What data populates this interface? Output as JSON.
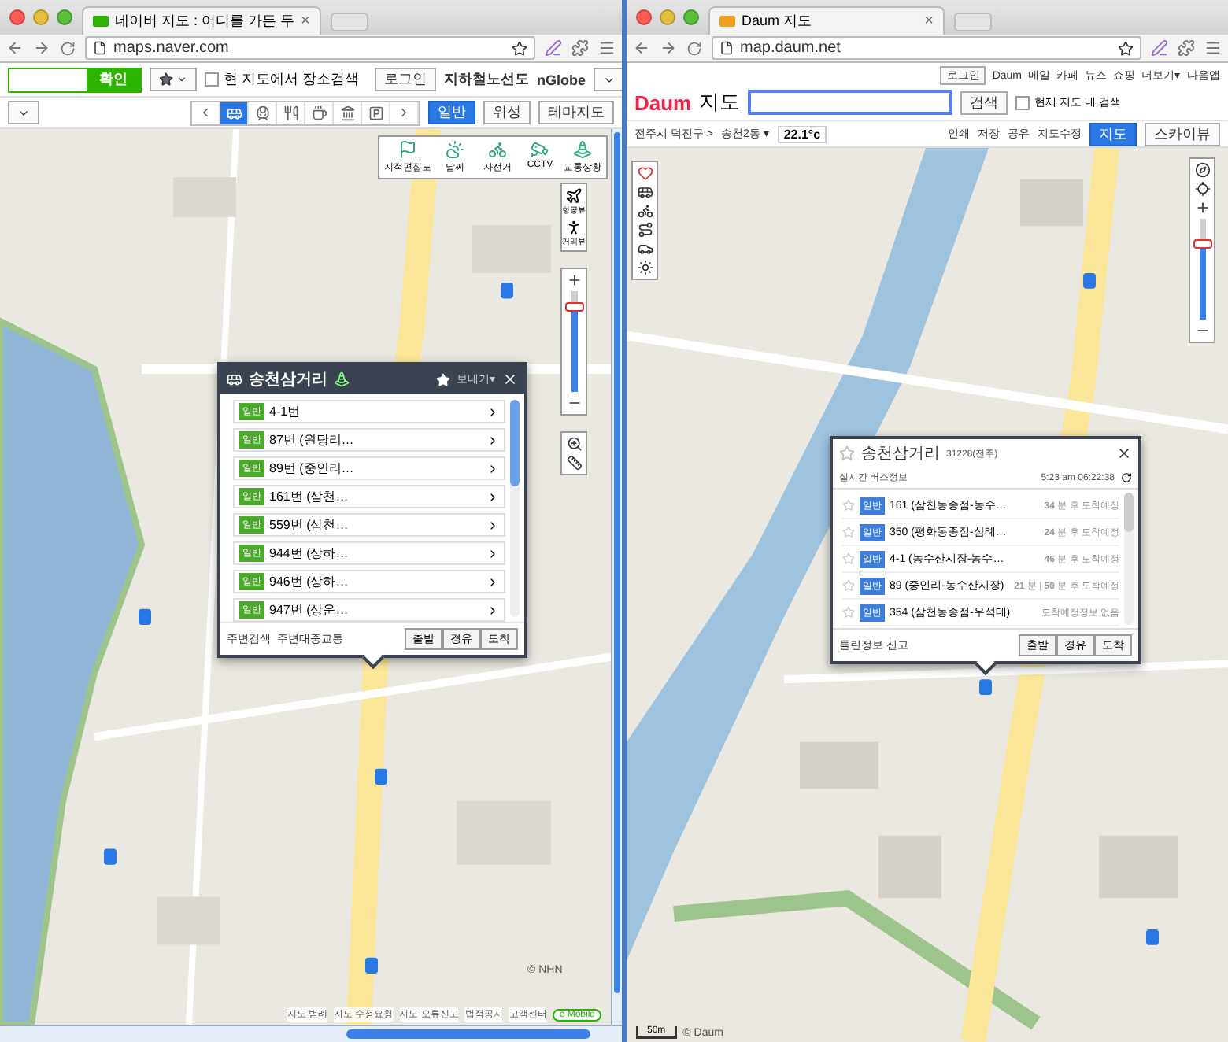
{
  "left_window": {
    "tab": {
      "title": "네이버 지도 : 어디를 가든 두",
      "close": "×"
    },
    "url": "maps.naver.com",
    "header": {
      "search_button": "확인",
      "place_search": {
        "label": "현 지도에서 장소검색",
        "checked": false
      },
      "login": "로그인",
      "links": [
        "지하철노선도",
        "nGlobe"
      ]
    },
    "categories": [
      {
        "kind": "bus",
        "selected": true
      },
      {
        "kind": "subway",
        "selected": false
      },
      {
        "kind": "restaurant",
        "selected": false
      },
      {
        "kind": "cafe",
        "selected": false
      },
      {
        "kind": "bank",
        "selected": false
      },
      {
        "kind": "parking",
        "selected": false
      }
    ],
    "map_types": [
      {
        "label": "일반",
        "selected": true
      },
      {
        "label": "위성",
        "selected": false
      },
      {
        "label": "테마지도",
        "selected": false
      }
    ],
    "layers": [
      {
        "label": "지적편집도",
        "kind": "flag"
      },
      {
        "label": "날씨",
        "kind": "weather"
      },
      {
        "label": "자전거",
        "kind": "bike"
      },
      {
        "label": "CCTV",
        "kind": "cctv"
      },
      {
        "label": "교통상황",
        "kind": "traffic"
      }
    ],
    "view_buttons": [
      "항공뷰",
      "거리뷰"
    ],
    "zoom": {
      "level": 0.85
    },
    "popup": {
      "title": "송천삼거리",
      "send": "보내기▾",
      "routes": [
        {
          "badge": "일반",
          "name": "4-1번"
        },
        {
          "badge": "일반",
          "name": "87번 (원당리…"
        },
        {
          "badge": "일반",
          "name": "89번 (중인리…"
        },
        {
          "badge": "일반",
          "name": "161번 (삼천…"
        },
        {
          "badge": "일반",
          "name": "559번 (삼천…"
        },
        {
          "badge": "일반",
          "name": "944번 (상하…"
        },
        {
          "badge": "일반",
          "name": "946번 (상하…"
        },
        {
          "badge": "일반",
          "name": "947번 (상운…"
        }
      ],
      "links": [
        "주변검색",
        "주변대중교통"
      ],
      "buttons": [
        "출발",
        "경유",
        "도착"
      ]
    },
    "footer": {
      "links": [
        "지도 범례",
        "지도 수정요청",
        "지도 오류신고",
        "법적공지",
        "고객센터"
      ],
      "copyright": "© NHN",
      "mobile": "e Mobile"
    }
  },
  "right_window": {
    "tab": {
      "title": "Daum 지도",
      "close": "×"
    },
    "url": "map.daum.net",
    "header": {
      "logo": "Daum",
      "logo_suffix": "지도",
      "login": "로그인",
      "links": [
        "Daum",
        "메일",
        "카페",
        "뉴스",
        "쇼핑",
        "더보기▾",
        "다음앱"
      ],
      "search_button": "검색",
      "area_search": {
        "label": "현재 지도 내 검색",
        "checked": false
      }
    },
    "breadcrumb": [
      "전주시 덕진구 >",
      "송천2동 ▾"
    ],
    "temperature": "22.1°c",
    "tools": [
      "인쇄",
      "저장",
      "공유",
      "지도수정"
    ],
    "map_types": [
      {
        "label": "지도",
        "selected": true
      },
      {
        "label": "스카이뷰",
        "selected": false
      }
    ],
    "zoom": {
      "level": 0.75
    },
    "popup": {
      "title": "송천삼거리",
      "code": "31228(전주)",
      "subtitle": "실시간 버스정보",
      "time": "5:23 am 06:22:38",
      "routes": [
        {
          "badge": "일반",
          "name": "161 (삼천동종점-농수…",
          "arrival": "**34** 분 후 도착예정"
        },
        {
          "badge": "일반",
          "name": "350 (평화동종점-삼례…",
          "arrival": "**24** 분 후 도착예정"
        },
        {
          "badge": "일반",
          "name": "4-1 (농수산시장-농수…",
          "arrival": "**46** 분 후 도착예정"
        },
        {
          "badge": "일반",
          "name": "89 (중인리-농수산시장)",
          "arrival": "**21** 분 | **50** 분 후 도착예정"
        },
        {
          "badge": "일반",
          "name": "354 (삼천동종점-우석대)",
          "arrival": "도착예정정보 없음"
        }
      ],
      "report": "틀린정보 신고",
      "buttons": [
        "출발",
        "경유",
        "도착"
      ]
    },
    "footer": {
      "scale": "50m",
      "copyright": "© Daum"
    }
  }
}
